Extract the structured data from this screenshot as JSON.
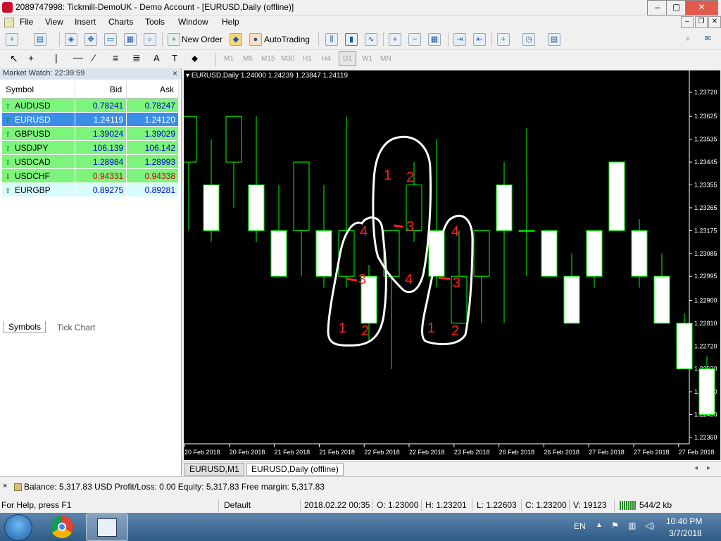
{
  "window": {
    "title": "2089747998: Tickmill-DemoUK - Demo Account - [EURUSD,Daily (offline)]",
    "controls": [
      "–",
      "▢",
      "✕"
    ],
    "inner_controls": [
      "–",
      "❐",
      "✕"
    ]
  },
  "menu": [
    "File",
    "View",
    "Insert",
    "Charts",
    "Tools",
    "Window",
    "Help"
  ],
  "toolbar": {
    "new_order": "New Order",
    "autotrading": "AutoTrading"
  },
  "timeframes": [
    "M1",
    "M5",
    "M15",
    "M30",
    "H1",
    "H4",
    "D1",
    "W1",
    "MN"
  ],
  "market_watch": {
    "title": "Market Watch: 22:39:59",
    "columns": [
      "Symbol",
      "Bid",
      "Ask"
    ],
    "rows": [
      {
        "symbol": "AUDUSD",
        "bid": "0.78241",
        "ask": "0.78247",
        "dir": "up",
        "bg": "#7df57d",
        "color": "#0000c8"
      },
      {
        "symbol": "EURUSD",
        "bid": "1.24119",
        "ask": "1.24120",
        "dir": "up",
        "bg": "#3a8ee8",
        "color": "#ffffff"
      },
      {
        "symbol": "GBPUSD",
        "bid": "1.39024",
        "ask": "1.39029",
        "dir": "up",
        "bg": "#7df57d",
        "color": "#0000c8"
      },
      {
        "symbol": "USDJPY",
        "bid": "106.139",
        "ask": "106.142",
        "dir": "up",
        "bg": "#7df57d",
        "color": "#0000c8"
      },
      {
        "symbol": "USDCAD",
        "bid": "1.28984",
        "ask": "1.28993",
        "dir": "up",
        "bg": "#7df57d",
        "color": "#0000c8"
      },
      {
        "symbol": "USDCHF",
        "bid": "0.94331",
        "ask": "0.94338",
        "dir": "down",
        "bg": "#7df57d",
        "color": "#c80000"
      },
      {
        "symbol": "EURGBP",
        "bid": "0.89275",
        "ask": "0.89281",
        "dir": "up",
        "bg": "#d8fbfb",
        "color": "#0000c8"
      }
    ],
    "tabs": [
      "Symbols",
      "Tick Chart"
    ]
  },
  "chart": {
    "header": "EURUSD,Daily  1.24000 1.24239 1.23847 1.24119",
    "price_labels": [
      "1.23720",
      "1.23625",
      "1.23535",
      "1.23445",
      "1.23355",
      "1.23265",
      "1.23175",
      "1.23085",
      "1.22995",
      "1.22900",
      "1.22810",
      "1.22720",
      "1.22630",
      "1.22540",
      "1.22450",
      "1.22360"
    ],
    "date_labels": [
      "20 Feb 2018",
      "20 Feb 2018",
      "21 Feb 2018",
      "21 Feb 2018",
      "22 Feb 2018",
      "22 Feb 2018",
      "23 Feb 2018",
      "26 Feb 2018",
      "26 Feb 2018",
      "27 Feb 2018",
      "27 Feb 2018",
      "27 Feb 2018"
    ],
    "candles": [
      {
        "o": 1.23445,
        "h": 1.23625,
        "l": 1.23175,
        "c": 1.23625
      },
      {
        "o": 1.23355,
        "h": 1.23535,
        "l": 1.2313,
        "c": 1.23175
      },
      {
        "o": 1.23445,
        "h": 1.23625,
        "l": 1.23265,
        "c": 1.23625
      },
      {
        "o": 1.23355,
        "h": 1.23625,
        "l": 1.2313,
        "c": 1.23175
      },
      {
        "o": 1.23175,
        "h": 1.23355,
        "l": 1.22995,
        "c": 1.22995
      },
      {
        "o": 1.23175,
        "h": 1.23445,
        "l": 1.22995,
        "c": 1.23445
      },
      {
        "o": 1.23175,
        "h": 1.23355,
        "l": 1.2295,
        "c": 1.22995
      },
      {
        "o": 1.22995,
        "h": 1.23625,
        "l": 1.2295,
        "c": 1.23175
      },
      {
        "o": 1.22995,
        "h": 1.2304,
        "l": 1.2274,
        "c": 1.2281
      },
      {
        "o": 1.22995,
        "h": 1.23175,
        "l": 1.2263,
        "c": 1.23175
      },
      {
        "o": 1.23175,
        "h": 1.23445,
        "l": 1.2313,
        "c": 1.23355
      },
      {
        "o": 1.23175,
        "h": 1.23535,
        "l": 1.2295,
        "c": 1.22995
      },
      {
        "o": 1.2281,
        "h": 1.23175,
        "l": 1.2281,
        "c": 1.22995
      },
      {
        "o": 1.22995,
        "h": 1.23175,
        "l": 1.2281,
        "c": 1.23175
      },
      {
        "o": 1.23355,
        "h": 1.23445,
        "l": 1.2281,
        "c": 1.23175
      },
      {
        "o": 1.23175,
        "h": 1.2358,
        "l": 1.22995,
        "c": 1.23175
      },
      {
        "o": 1.23175,
        "h": 1.2313,
        "l": 1.22995,
        "c": 1.22995
      },
      {
        "o": 1.22995,
        "h": 1.23085,
        "l": 1.2281,
        "c": 1.2281
      },
      {
        "o": 1.23175,
        "h": 1.23175,
        "l": 1.2295,
        "c": 1.22995
      },
      {
        "o": 1.23445,
        "h": 1.23445,
        "l": 1.23175,
        "c": 1.23175
      },
      {
        "o": 1.23175,
        "h": 1.2322,
        "l": 1.2295,
        "c": 1.22995
      },
      {
        "o": 1.22995,
        "h": 1.23085,
        "l": 1.2281,
        "c": 1.2281
      },
      {
        "o": 1.2281,
        "h": 1.2285,
        "l": 1.2263,
        "c": 1.2263
      },
      {
        "o": 1.2263,
        "h": 1.2268,
        "l": 1.2245,
        "c": 1.2245
      },
      {
        "o": 1.2245,
        "h": 1.2254,
        "l": 1.2236,
        "c": 1.2236
      }
    ],
    "annotations": [
      "1",
      "2",
      "3",
      "4",
      "1",
      "2",
      "3",
      "4",
      "1",
      "2",
      "3",
      "4"
    ]
  },
  "chart_tabs": [
    "EURUSD,M1",
    "EURUSD,Daily (offline)"
  ],
  "terminal": {
    "text": "Balance: 5,317.83 USD  Profit/Loss: 0.00  Equity: 5,317.83  Free margin: 5,317.83"
  },
  "status_bar": {
    "help": "For Help, press F1",
    "profile": "Default",
    "datetime": "2018.02.22 00:35",
    "open": "O: 1.23000",
    "high": "H: 1.23201",
    "low": "L: 1.22603",
    "close": "C: 1.23200",
    "volume": "V: 19123",
    "traffic": "544/2 kb"
  },
  "taskbar": {
    "lang": "EN",
    "time": "10:40 PM",
    "date": "3/7/2018"
  }
}
